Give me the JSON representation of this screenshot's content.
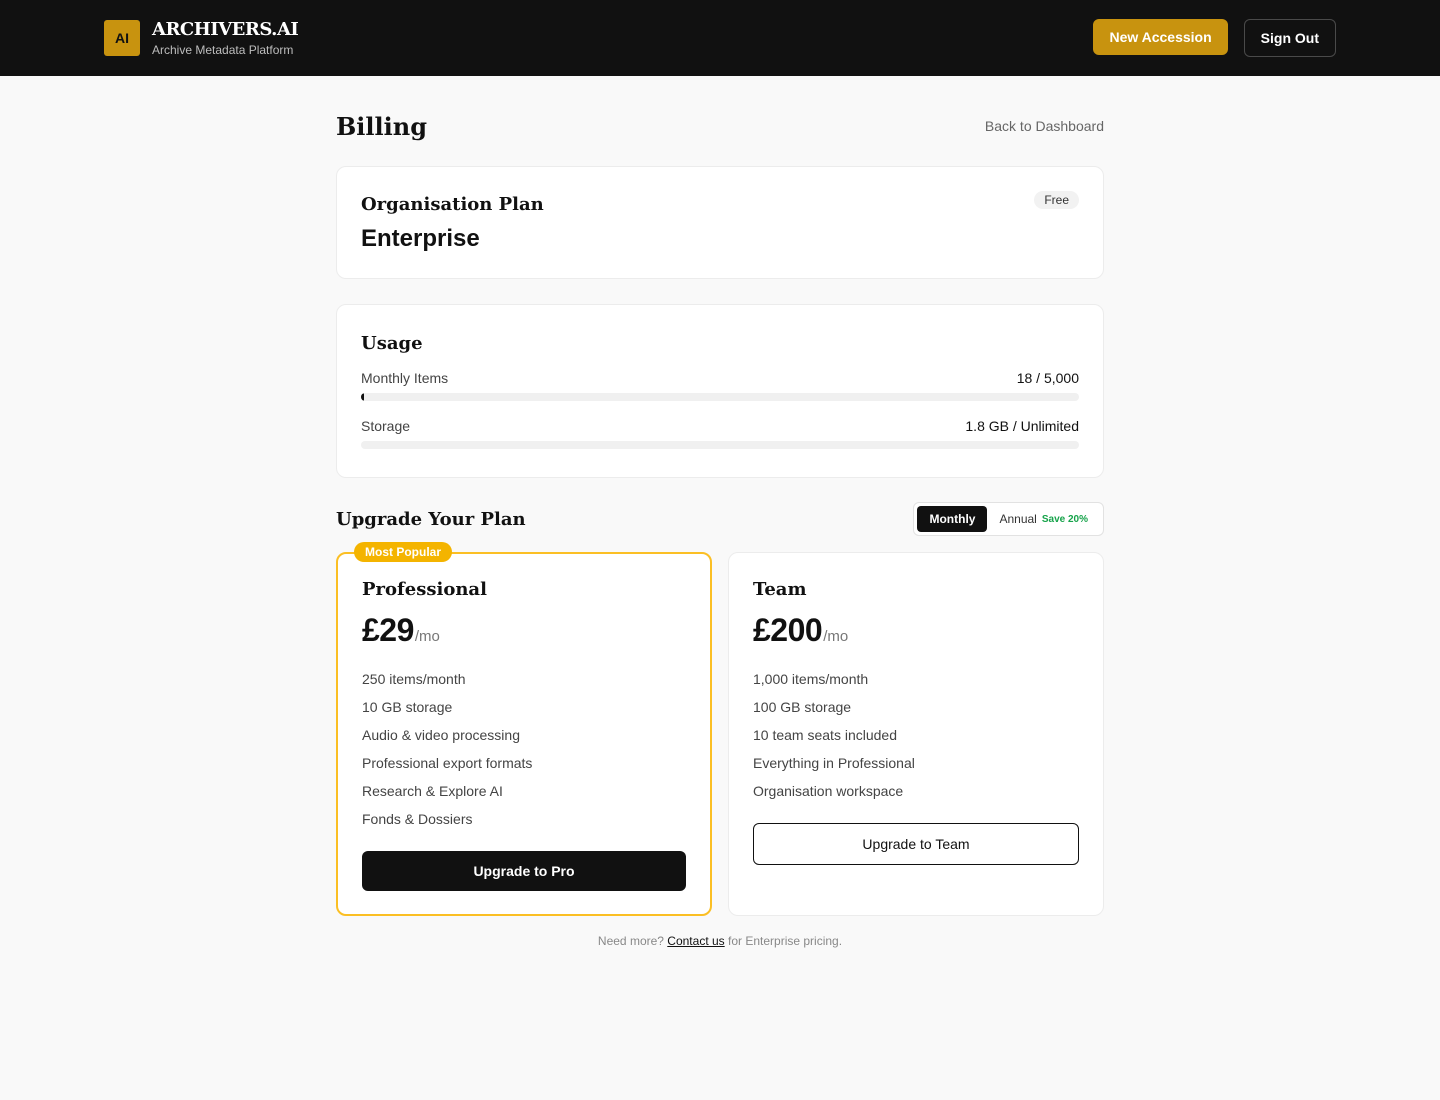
{
  "header": {
    "logo_text": "AI",
    "brand_name": "ARCHIVERS.AI",
    "brand_subtitle": "Archive Metadata Platform",
    "new_accession_label": "New Accession",
    "sign_out_label": "Sign Out"
  },
  "page": {
    "title": "Billing",
    "back_link": "Back to Dashboard"
  },
  "plan": {
    "label": "Organisation Plan",
    "name": "Enterprise",
    "badge": "Free"
  },
  "usage": {
    "title": "Usage",
    "items": [
      {
        "label": "Monthly Items",
        "value": "18 / 5,000",
        "fraction": 0.0036
      },
      {
        "label": "Storage",
        "value": "1.8 GB / Unlimited",
        "fraction": 0
      }
    ]
  },
  "upgrade": {
    "title": "Upgrade Your Plan",
    "toggle": {
      "monthly": "Monthly",
      "annual": "Annual",
      "save": "Save 20%",
      "selected": "monthly"
    },
    "plans": [
      {
        "ribbon": "Most Popular",
        "name": "Professional",
        "price": "£29",
        "period": "/mo",
        "features": [
          "250 items/month",
          "10 GB storage",
          "Audio & video processing",
          "Professional export formats",
          "Research & Explore AI",
          "Fonds & Dossiers"
        ],
        "cta": "Upgrade to Pro"
      },
      {
        "name": "Team",
        "price": "£200",
        "period": "/mo",
        "features": [
          "1,000 items/month",
          "100 GB storage",
          "10 team seats included",
          "Everything in Professional",
          "Organisation workspace"
        ],
        "cta": "Upgrade to Team"
      }
    ]
  },
  "footer": {
    "before": "Need more? ",
    "link": "Contact us",
    "after": " for Enterprise pricing."
  },
  "colors": {
    "accent_gold": "#c8930f",
    "popular_border": "#fbbf24",
    "save_green": "#16a34a",
    "header_bg": "#111111"
  }
}
